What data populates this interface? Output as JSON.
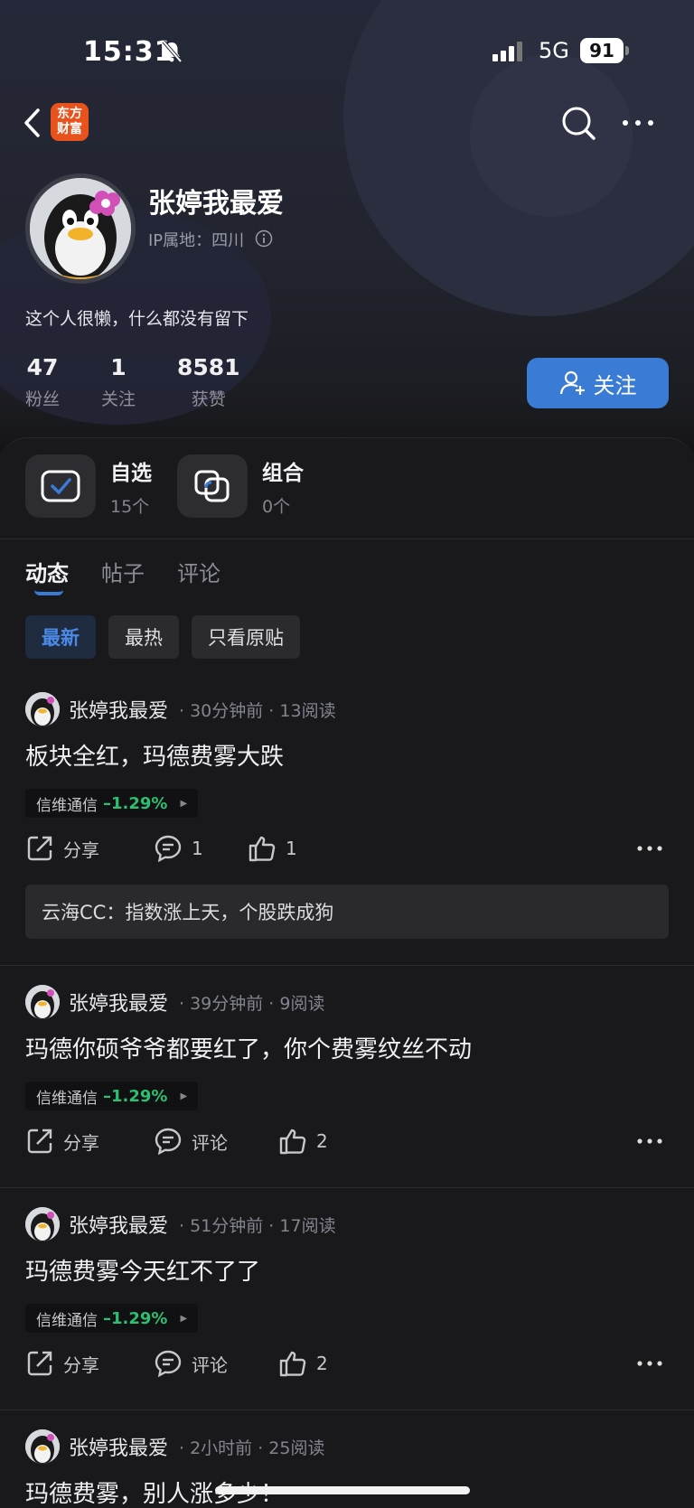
{
  "status_bar": {
    "time": "15:31",
    "network": "5G",
    "battery": "91"
  },
  "nav": {
    "logo_line1": "东方",
    "logo_line2": "财富"
  },
  "profile": {
    "name": "张婷我最爱",
    "ip_location": "IP属地：四川",
    "bio": "这个人很懒，什么都没有留下",
    "stats": [
      {
        "value": "47",
        "label": "粉丝"
      },
      {
        "value": "1",
        "label": "关注"
      },
      {
        "value": "8581",
        "label": "获赞"
      }
    ],
    "follow_label": "关注"
  },
  "quick_links": [
    {
      "title": "自选",
      "count": "15个"
    },
    {
      "title": "组合",
      "count": "0个"
    }
  ],
  "tabs": [
    "动态",
    "帖子",
    "评论"
  ],
  "filters": [
    "最新",
    "最热",
    "只看原贴"
  ],
  "posts": [
    {
      "author": "张婷我最爱",
      "meta": "· 30分钟前 · 13阅读",
      "title": "板块全红，玛德费雾大跌",
      "stock_name": "信维通信",
      "stock_change": "–1.29%",
      "share": "分享",
      "comments": "1",
      "likes": "1",
      "top_comment": "云海CC：指数涨上天，个股跌成狗"
    },
    {
      "author": "张婷我最爱",
      "meta": "· 39分钟前 · 9阅读",
      "title": "玛德你硕爷爷都要红了，你个费雾纹丝不动",
      "stock_name": "信维通信",
      "stock_change": "–1.29%",
      "share": "分享",
      "comments": "评论",
      "likes": "2"
    },
    {
      "author": "张婷我最爱",
      "meta": "· 51分钟前 · 17阅读",
      "title": "玛德费雾今天红不了了",
      "stock_name": "信维通信",
      "stock_change": "–1.29%",
      "share": "分享",
      "comments": "评论",
      "likes": "2"
    },
    {
      "author": "张婷我最爱",
      "meta": "· 2小时前 · 25阅读",
      "title": "玛德费雾，别人涨多少！"
    }
  ],
  "colors": {
    "accent": "#3a7bd5",
    "down": "#2fbf71",
    "background": "#19191c"
  }
}
